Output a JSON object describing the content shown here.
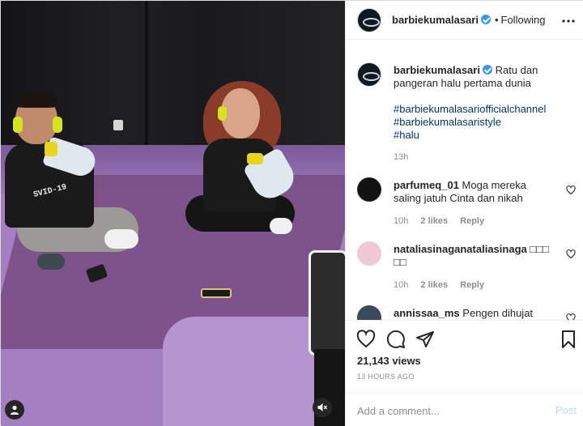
{
  "post": {
    "username": "barbiekumalasari",
    "follow_separator": "•",
    "follow_status": "Following",
    "more_icon": "more-horizontal-icon"
  },
  "media": {
    "shirt_text": "SVID-19",
    "profile_icon": "user-icon",
    "audio_icon": "speaker-muted-icon"
  },
  "caption": {
    "username": "barbiekumalasari",
    "text": "Ratu dan pangeran halu pertama dunia",
    "hashtags": [
      "#barbiekumalasariofficialchannel",
      "#barbiekumalasaristyle",
      "#halu"
    ],
    "time": "13h"
  },
  "comments": [
    {
      "username": "parfumeq_01",
      "text": "Moga mereka saling jatuh Cinta dan nikah",
      "time": "10h",
      "likes": "2 likes",
      "reply": "Reply"
    },
    {
      "username": "nataliasinaganataliasinaga",
      "text": "□□□ □□",
      "time": "10h",
      "likes": "2 likes",
      "reply": "Reply"
    },
    {
      "username": "annissaa_ms",
      "text": "Pengen dihujat",
      "time": "",
      "likes": "",
      "reply": ""
    }
  ],
  "stats": {
    "views": "21,143 views",
    "posted_ago": "13 HOURS AGO"
  },
  "add_comment": {
    "placeholder": "Add a comment...",
    "post_label": "Post"
  },
  "colors": {
    "link": "#00376b",
    "verified": "#3897f0",
    "post_disabled": "#b2dffc",
    "floor": "#a47fc2"
  }
}
